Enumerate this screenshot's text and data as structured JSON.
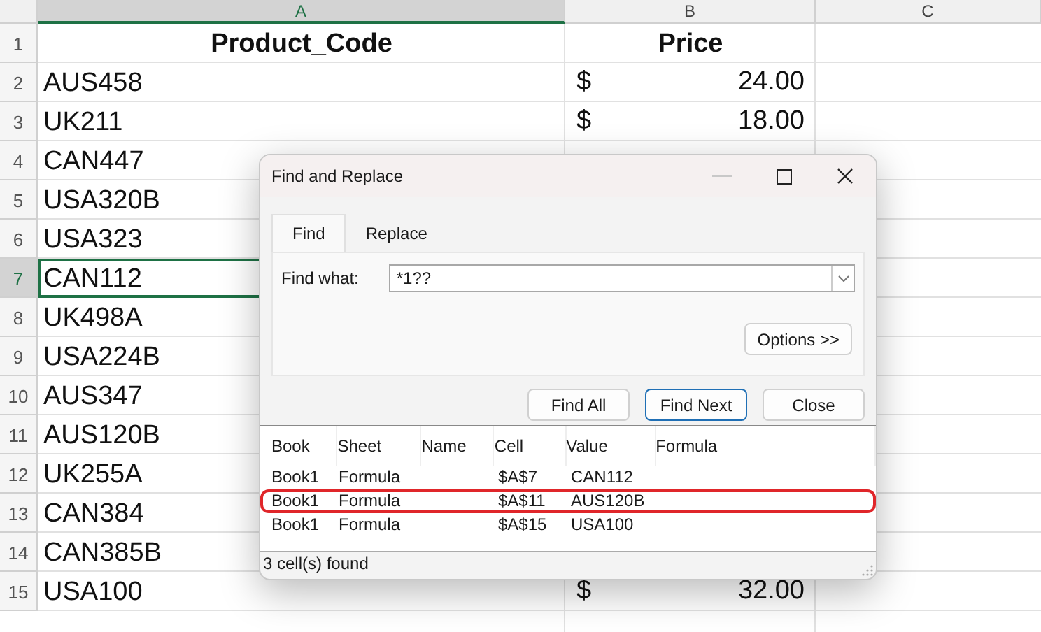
{
  "sheet": {
    "columns": [
      {
        "label": "A",
        "selected": true
      },
      {
        "label": "B",
        "selected": false
      },
      {
        "label": "C",
        "selected": false
      }
    ],
    "rows": [
      {
        "number": "1",
        "kind": "header",
        "selected": false,
        "product": "Product_Code",
        "price": "Price"
      },
      {
        "number": "2",
        "kind": "data",
        "selected": false,
        "product": "AUS458",
        "currency": "$",
        "price": "24.00"
      },
      {
        "number": "3",
        "kind": "data",
        "selected": false,
        "product": "UK211",
        "currency": "$",
        "price": "18.00"
      },
      {
        "number": "4",
        "kind": "data",
        "selected": false,
        "product": "CAN447"
      },
      {
        "number": "5",
        "kind": "data",
        "selected": false,
        "product": "USA320B"
      },
      {
        "number": "6",
        "kind": "data",
        "selected": false,
        "product": "USA323"
      },
      {
        "number": "7",
        "kind": "data",
        "selected": true,
        "product": "CAN112"
      },
      {
        "number": "8",
        "kind": "data",
        "selected": false,
        "product": "UK498A"
      },
      {
        "number": "9",
        "kind": "data",
        "selected": false,
        "product": "USA224B"
      },
      {
        "number": "10",
        "kind": "data",
        "selected": false,
        "product": "AUS347"
      },
      {
        "number": "11",
        "kind": "data",
        "selected": false,
        "product": "AUS120B"
      },
      {
        "number": "12",
        "kind": "data",
        "selected": false,
        "product": "UK255A"
      },
      {
        "number": "13",
        "kind": "data",
        "selected": false,
        "product": "CAN384"
      },
      {
        "number": "14",
        "kind": "data",
        "selected": false,
        "product": "CAN385B"
      },
      {
        "number": "15",
        "kind": "data",
        "selected": false,
        "product": "USA100",
        "currency": "$",
        "price": "32.00"
      }
    ]
  },
  "dialog": {
    "title": "Find and Replace",
    "tabs": [
      {
        "label": "Find",
        "selected": true
      },
      {
        "label": "Replace",
        "selected": false
      }
    ],
    "find_what": {
      "label": "Find what:",
      "value": "*1??"
    },
    "options_button": "Options >>",
    "buttons": [
      {
        "label": "Find All",
        "default": false
      },
      {
        "label": "Find Next",
        "default": true
      },
      {
        "label": "Close",
        "default": false
      }
    ],
    "results": {
      "columns": [
        "Book",
        "Sheet",
        "Name",
        "Cell",
        "Value",
        "Formula"
      ],
      "rows": [
        {
          "book": "Book1",
          "sheet": "Formula",
          "cell": "$A$7",
          "value": "CAN112",
          "highlighted": false
        },
        {
          "book": "Book1",
          "sheet": "Formula",
          "cell": "$A$11",
          "value": "AUS120B",
          "highlighted": true
        },
        {
          "book": "Book1",
          "sheet": "Formula",
          "cell": "$A$15",
          "value": "USA100",
          "highlighted": false
        }
      ]
    },
    "status": "3 cell(s) found"
  }
}
